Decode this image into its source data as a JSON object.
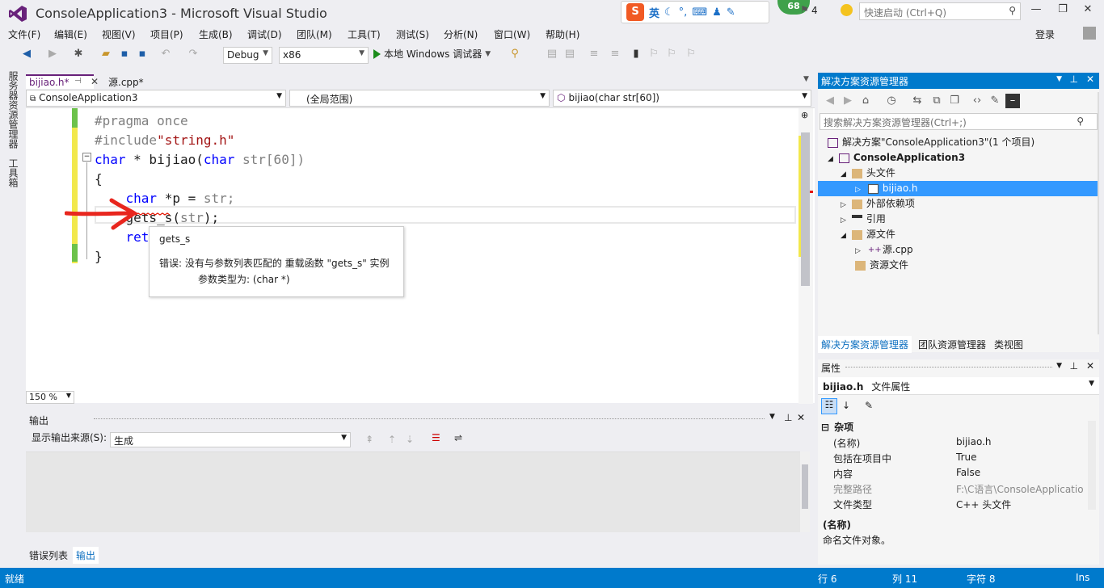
{
  "window": {
    "title": "ConsoleApplication3 - Microsoft Visual Studio",
    "ime_label": "英",
    "badge_count": "68",
    "flag_count": "4",
    "quick_launch_placeholder": "快速启动 (Ctrl+Q)",
    "login": "登录"
  },
  "menu": [
    "文件(F)",
    "编辑(E)",
    "视图(V)",
    "项目(P)",
    "生成(B)",
    "调试(D)",
    "团队(M)",
    "工具(T)",
    "测试(S)",
    "分析(N)",
    "窗口(W)",
    "帮助(H)"
  ],
  "toolbar": {
    "config": "Debug",
    "platform": "x86",
    "run_label": "本地 Windows 调试器"
  },
  "left_rail": [
    "服务器资源管理器",
    "工具箱"
  ],
  "tabs": [
    {
      "label": "bijiao.h*"
    },
    {
      "label": "源.cpp*"
    }
  ],
  "navbar": {
    "project": "ConsoleApplication3",
    "scope": "(全局范围)",
    "member": "bijiao(char str[60])"
  },
  "code": {
    "l1": "#pragma once",
    "l2_pp": "#include",
    "l2_str": "\"string.h\"",
    "l3_kw1": "char",
    "l3_mid": " * bijiao(",
    "l3_kw2": "char",
    "l3_end": " str[60])",
    "l4": "{",
    "l5_kw": "    char",
    "l5_mid": " *p = ",
    "l5_end": "str;",
    "l6_fn": "    gets_s",
    "l6_mid": "(",
    "l6_arg": "str",
    "l6_end": ");",
    "l7": "    ret",
    "l8": "}"
  },
  "tooltip": {
    "title": "gets_s",
    "line1": "错误: 没有与参数列表匹配的 重载函数 \"gets_s\" 实例",
    "line2": "参数类型为: (char *)"
  },
  "zoom": "150 %",
  "output": {
    "title": "输出",
    "source_label": "显示输出来源(S):",
    "source_value": "生成"
  },
  "bottom_tabs": [
    "错误列表",
    "输出"
  ],
  "solution": {
    "title": "解决方案资源管理器",
    "search_placeholder": "搜索解决方案资源管理器(Ctrl+;)",
    "items": [
      {
        "label": "解决方案\"ConsoleApplication3\"(1 个项目)"
      },
      {
        "label": "ConsoleApplication3"
      },
      {
        "label": "头文件"
      },
      {
        "label": "bijiao.h"
      },
      {
        "label": "外部依赖项"
      },
      {
        "label": "引用"
      },
      {
        "label": "源文件"
      },
      {
        "label": "源.cpp"
      },
      {
        "label": "资源文件"
      }
    ],
    "tabs": [
      "解决方案资源管理器",
      "团队资源管理器",
      "类视图"
    ]
  },
  "properties": {
    "title": "属性",
    "object_name": "bijiao.h",
    "object_type": "文件属性",
    "category": "杂项",
    "rows": [
      {
        "k": "(名称)",
        "v": "bijiao.h"
      },
      {
        "k": "包括在项目中",
        "v": "True"
      },
      {
        "k": "内容",
        "v": "False"
      },
      {
        "k": "完整路径",
        "v": "F:\\C语言\\ConsoleApplicatio"
      },
      {
        "k": "文件类型",
        "v": "C++ 头文件"
      }
    ],
    "desc_title": "(名称)",
    "desc_text": "命名文件对象。"
  },
  "status": {
    "ready": "就绪",
    "line": "行 6",
    "col": "列 11",
    "ch": "字符 8",
    "mode": "Ins"
  },
  "colors": {
    "accent": "#007acc",
    "vs_purple": "#68217a",
    "annotation_red": "#e8261e"
  }
}
